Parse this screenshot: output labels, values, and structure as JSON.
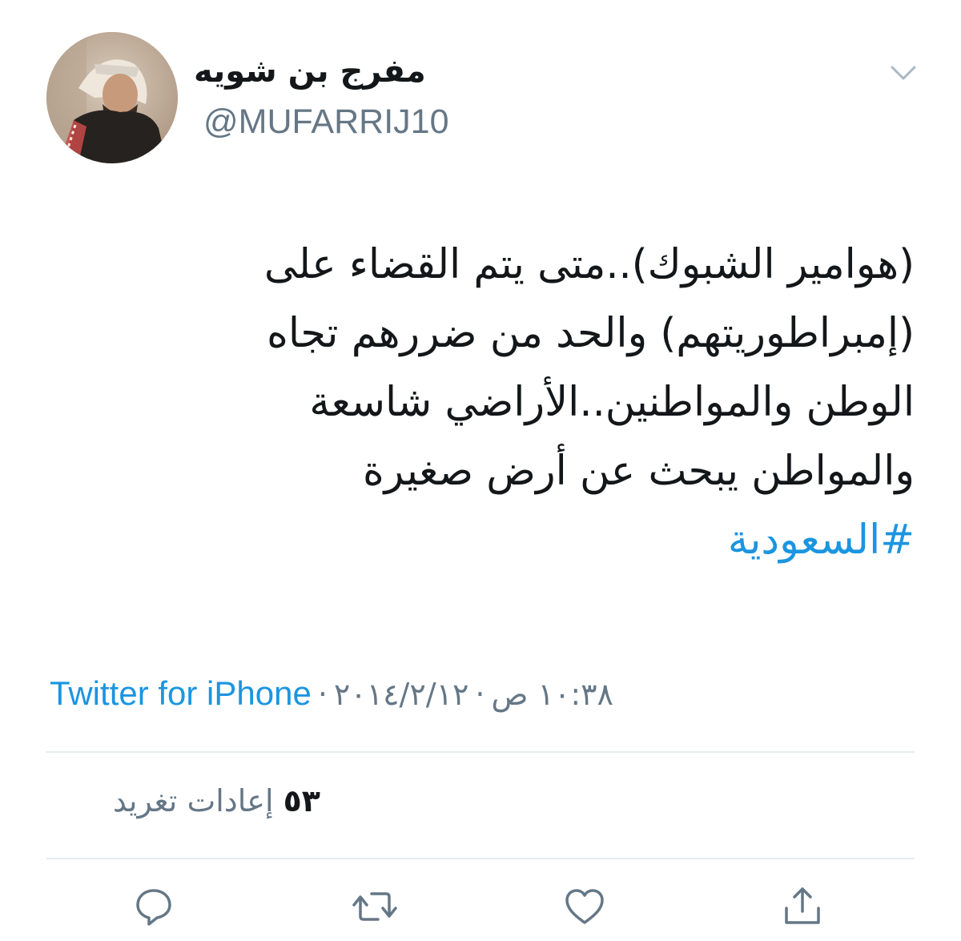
{
  "tweet": {
    "display_name": "مفرج بن شويه",
    "handle": "@MUFARRIJ10",
    "text_lines": [
      "(هوامير الشبوك)..متى يتم القضاء على",
      "(إمبراطوريتهم) والحد من ضررهم تجاه",
      "الوطن والمواطنين..الأراضي شاسعة",
      "والمواطن يبحث عن أرض صغيرة"
    ],
    "hashtag": "#السعودية",
    "time": "١٠:٣٨ ص",
    "date": "٢٠١٤/٢/١٢",
    "separator": "·",
    "source": "Twitter for iPhone",
    "retweet_count": "٥٣",
    "retweet_label": "إعادات تغريد"
  },
  "icons": {
    "caret": "chevron-down-icon",
    "reply": "reply-icon",
    "retweet": "retweet-icon",
    "like": "heart-icon",
    "share": "share-icon"
  },
  "colors": {
    "link": "#1b95e0",
    "secondary_text": "#657786",
    "primary_text": "#14171a",
    "divider": "#e6ecf0",
    "icon": "#657786"
  }
}
